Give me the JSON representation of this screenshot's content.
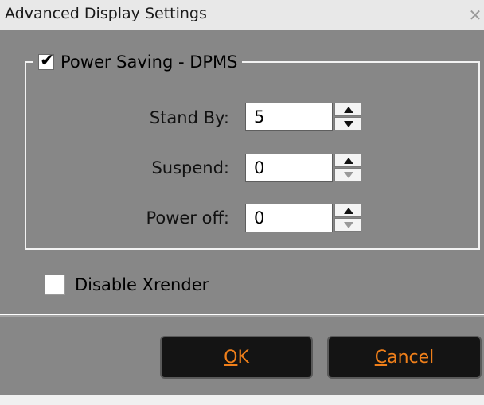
{
  "window": {
    "title": "Advanced Display Settings",
    "close_glyph": "✕"
  },
  "dpms": {
    "label": "Power Saving - DPMS",
    "checked": true,
    "fields": [
      {
        "label": "Stand By:",
        "value": "5",
        "up_enabled": true,
        "down_enabled": true
      },
      {
        "label": "Suspend:",
        "value": "0",
        "up_enabled": true,
        "down_enabled": false
      },
      {
        "label": "Power off:",
        "value": "0",
        "up_enabled": true,
        "down_enabled": false
      }
    ]
  },
  "xrender": {
    "label": "Disable Xrender",
    "checked": false
  },
  "buttons": {
    "ok": {
      "mnemonic": "O",
      "rest": "K"
    },
    "cancel": {
      "mnemonic": "C",
      "rest": "ancel"
    }
  },
  "colors": {
    "panel": "#878787",
    "button_bg": "#141414",
    "button_text": "#ef7f1a"
  }
}
